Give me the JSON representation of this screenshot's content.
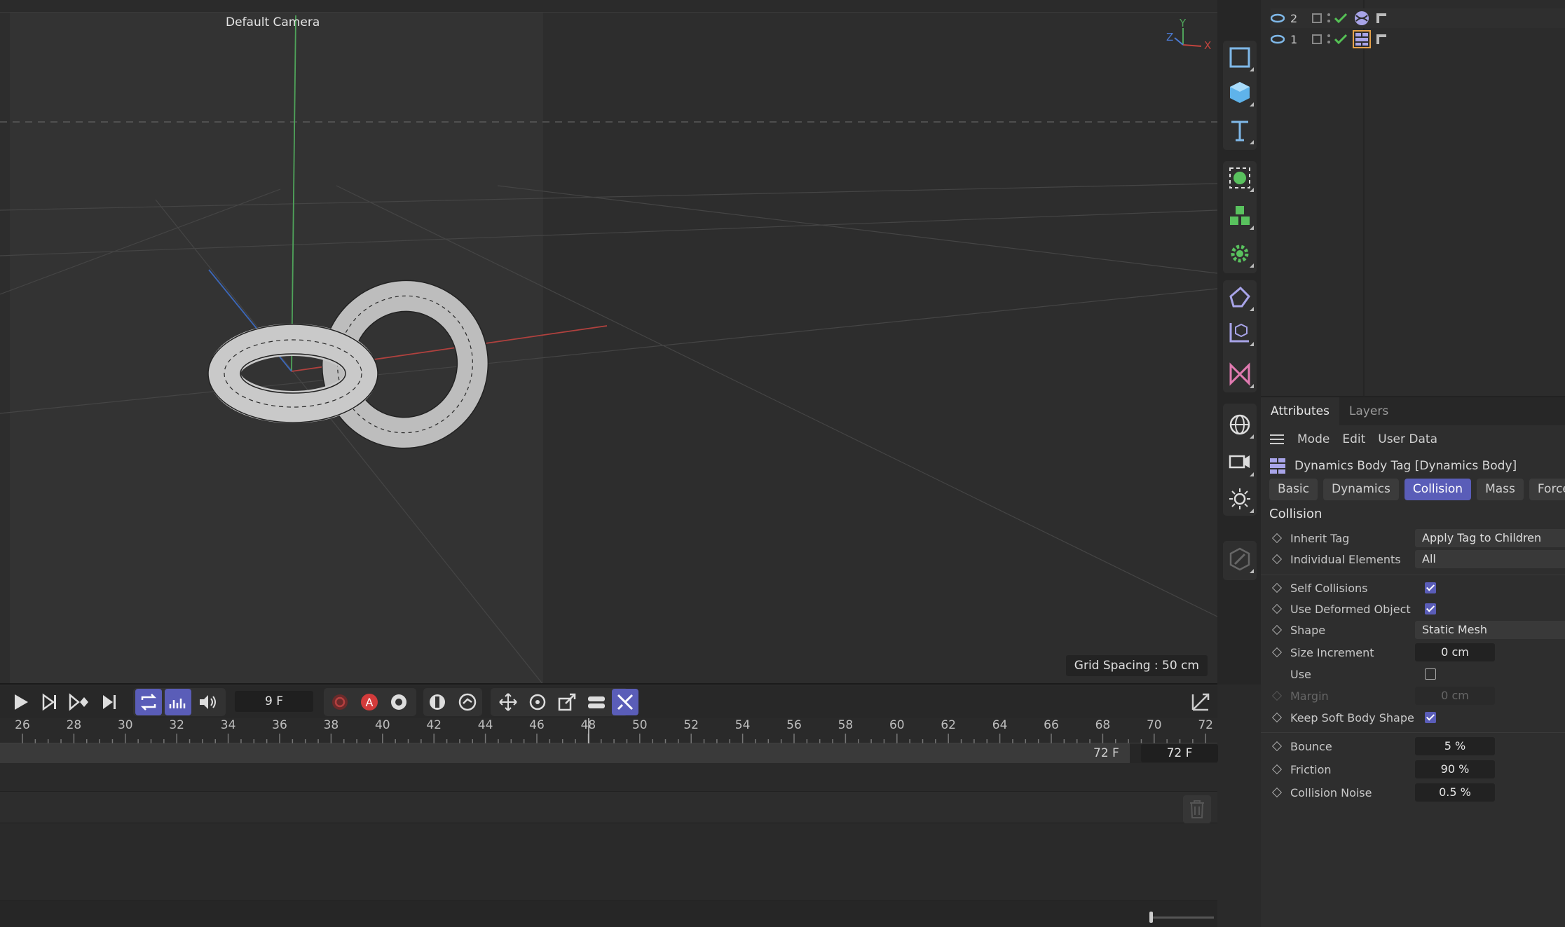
{
  "viewport": {
    "camera_label": "Default Camera",
    "grid_spacing": "Grid Spacing : 50 cm",
    "axis_labels": {
      "x": "X",
      "y": "Y",
      "z": "Z"
    }
  },
  "palette": {
    "icons": [
      "spline-pen-icon",
      "primitive-square-icon",
      "cube-icon",
      "text-icon",
      "generator-icon",
      "cloner-icon",
      "deformer-icon",
      "field-icon",
      "scene-object-icon",
      "camera-tool-icon",
      "environment-icon",
      "camera-st-icon",
      "light-st-icon",
      "edit-icon"
    ]
  },
  "objects": [
    {
      "name": "2",
      "icon": "sphere-tag-icon",
      "selected": true
    },
    {
      "name": "1",
      "icon": "dynamics-tag-icon",
      "selected": false
    }
  ],
  "attributes": {
    "tabs": [
      "Attributes",
      "Layers"
    ],
    "menu": [
      "Mode",
      "Edit",
      "User Data"
    ],
    "tag_title": "Dynamics Body Tag [Dynamics Body]",
    "subtabs": [
      "Basic",
      "Dynamics",
      "Collision",
      "Mass",
      "Force"
    ],
    "active_subtab": "Collision",
    "section": "Collision",
    "props": {
      "inherit_tag": {
        "label": "Inherit Tag",
        "value": "Apply Tag to Children"
      },
      "individual_elements": {
        "label": "Individual Elements",
        "value": "All"
      },
      "self_collisions": {
        "label": "Self Collisions",
        "checked": true
      },
      "use_deformed": {
        "label": "Use Deformed Object",
        "checked": true
      },
      "shape": {
        "label": "Shape",
        "value": "Static Mesh"
      },
      "size_increment": {
        "label": "Size Increment",
        "value": "0 cm"
      },
      "use": {
        "label": "Use",
        "checked": false
      },
      "margin": {
        "label": "Margin",
        "value": "0 cm"
      },
      "keep_soft_body": {
        "label": "Keep Soft Body Shape",
        "checked": true
      },
      "bounce": {
        "label": "Bounce",
        "value": "5 %"
      },
      "friction": {
        "label": "Friction",
        "value": "90 %"
      },
      "collision_noise": {
        "label": "Collision Noise",
        "value": "0.5 %"
      }
    }
  },
  "timeline": {
    "current_frame": "9 F",
    "ruler_labels": [
      "26",
      "28",
      "30",
      "32",
      "34",
      "36",
      "38",
      "40",
      "42",
      "44",
      "46",
      "48",
      "50",
      "52",
      "54",
      "56",
      "58",
      "60",
      "62",
      "64",
      "66",
      "68",
      "70",
      "72"
    ],
    "end_frame": "72 F",
    "end_frame_box": "72 F",
    "record_label": "A"
  }
}
